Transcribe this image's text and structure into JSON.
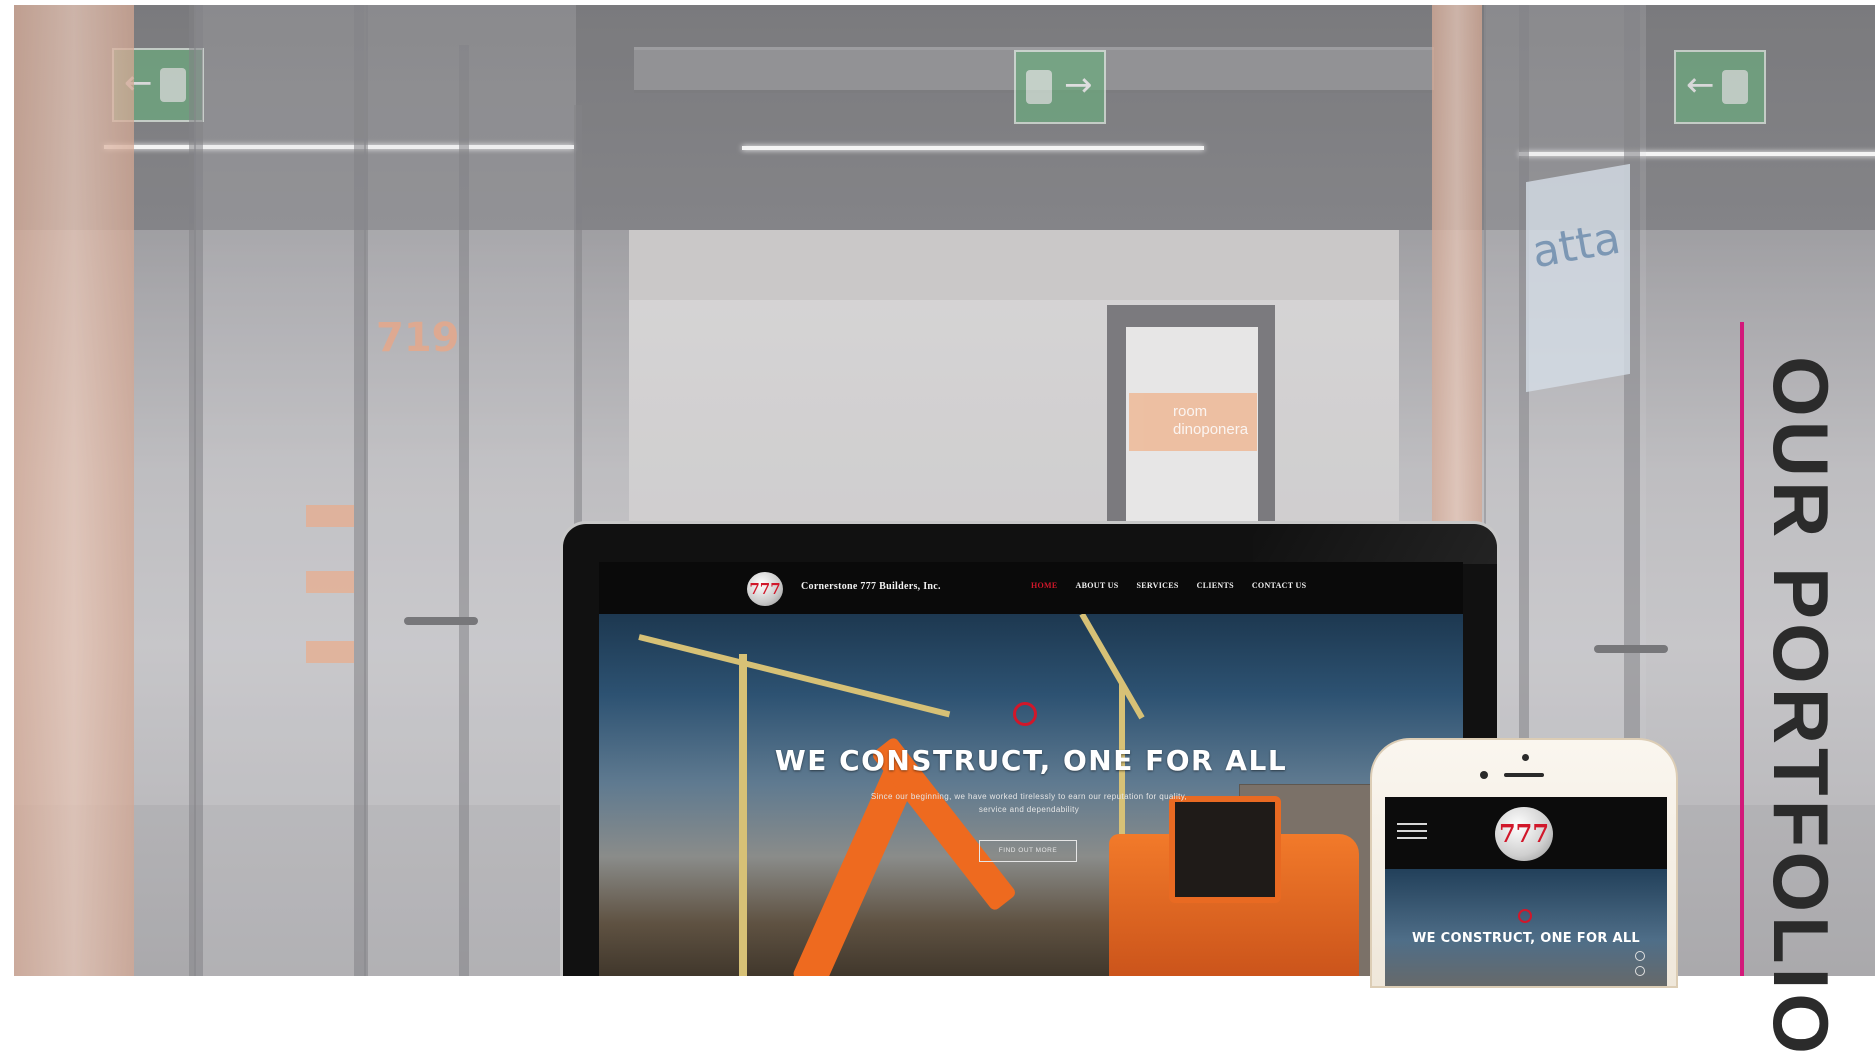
{
  "section": {
    "title": "OUR PORTFOLIO"
  },
  "background": {
    "room_sign_number": "719",
    "room_sign_label": "room dinoponera",
    "glass_wall_text": "atta",
    "accent_color": "#d2197a"
  },
  "laptop_site": {
    "logo_text": "777",
    "company_name": "Cornerstone 777 Builders, Inc.",
    "nav": [
      {
        "label": "HOME",
        "active": true
      },
      {
        "label": "ABOUT US",
        "active": false
      },
      {
        "label": "SERVICES",
        "active": false
      },
      {
        "label": "CLIENTS",
        "active": false
      },
      {
        "label": "CONTACT US",
        "active": false
      }
    ],
    "hero_headline": "WE CONSTRUCT, ONE FOR ALL",
    "hero_subtext": "Since our beginning, we have worked tirelessly to earn our reputation for quality, service and dependability",
    "cta_label": "FIND OUT MORE",
    "brand_color": "#d1172a"
  },
  "phone_site": {
    "logo_text": "777",
    "hero_headline": "WE CONSTRUCT, ONE FOR ALL"
  }
}
